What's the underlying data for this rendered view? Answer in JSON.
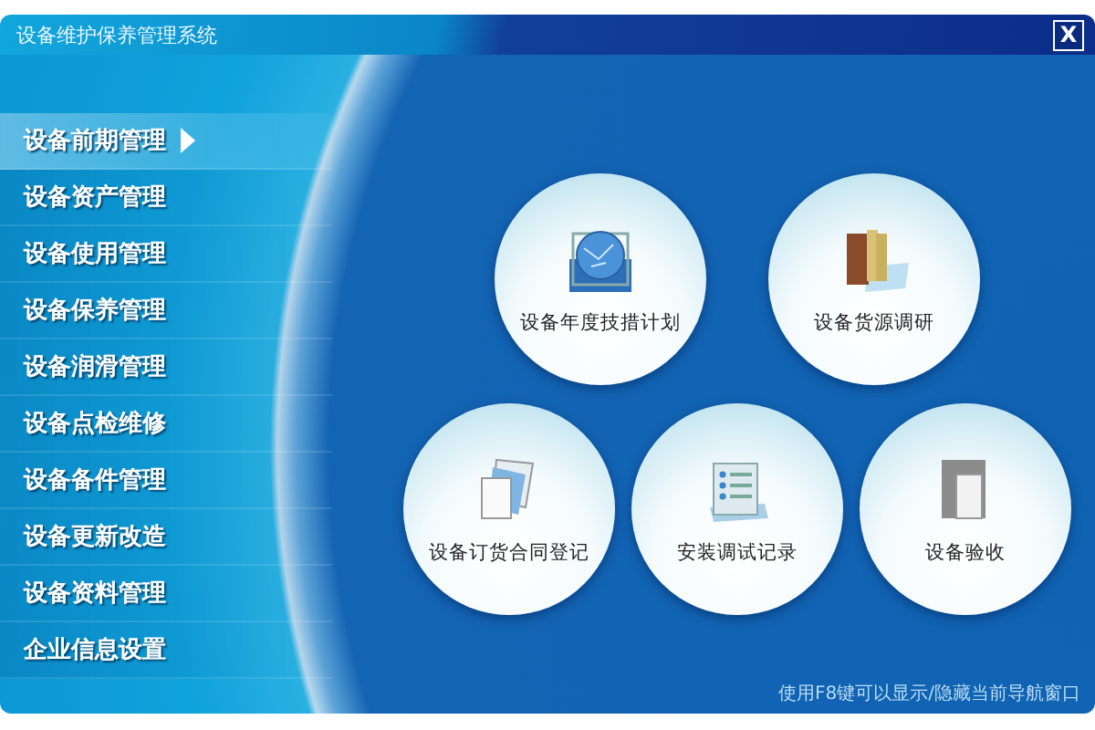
{
  "window": {
    "title": "设备维护保养管理系统",
    "close": "X"
  },
  "sidebar": {
    "items": [
      {
        "label": "设备前期管理",
        "selected": true
      },
      {
        "label": "设备资产管理",
        "selected": false
      },
      {
        "label": "设备使用管理",
        "selected": false
      },
      {
        "label": "设备保养管理",
        "selected": false
      },
      {
        "label": "设备润滑管理",
        "selected": false
      },
      {
        "label": "设备点检维修",
        "selected": false
      },
      {
        "label": "设备备件管理",
        "selected": false
      },
      {
        "label": "设备更新改造",
        "selected": false
      },
      {
        "label": "设备资料管理",
        "selected": false
      },
      {
        "label": "企业信息设置",
        "selected": false
      }
    ]
  },
  "tiles": [
    [
      {
        "label": "设备年度技措计划",
        "kind": "globe"
      },
      {
        "label": "设备货源调研",
        "kind": "books"
      }
    ],
    [
      {
        "label": "设备订货合同登记",
        "kind": "papers"
      },
      {
        "label": "安装调试记录",
        "kind": "checklist"
      },
      {
        "label": "设备验收",
        "kind": "door"
      }
    ]
  ],
  "status_bar": {
    "hint": "使用F8键可以显示/隐藏当前导航窗口"
  }
}
